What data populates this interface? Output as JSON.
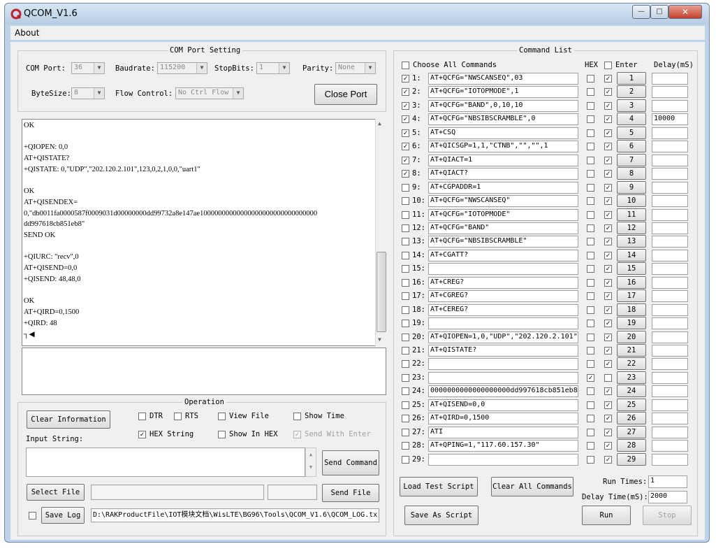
{
  "window": {
    "title": "QCOM_V1.6",
    "minimize_glyph": "—",
    "maximize_glyph": "□",
    "close_glyph": "✕"
  },
  "menu": {
    "about": "About"
  },
  "com_port": {
    "group_title": "COM Port Setting",
    "port_label": "COM Port:",
    "port_value": "36",
    "baud_label": "Baudrate:",
    "baud_value": "115200",
    "stopbits_label": "StopBits:",
    "stopbits_value": "1",
    "parity_label": "Parity:",
    "parity_value": "None",
    "bytesize_label": "ByteSize:",
    "bytesize_value": "8",
    "flow_label": "Flow Control:",
    "flow_value": "No Ctrl Flow",
    "close_port": "Close Port"
  },
  "log_lines": [
    "OK",
    "",
    "+QIOPEN: 0,0",
    "AT+QISTATE?",
    "+QISTATE: 0,\"UDP\",\"202.120.2.101\",123,0,2,1,0,0,\"uart1\"",
    "",
    "OK",
    "AT+QISENDEX=",
    "0,\"db0011fa0000587f0009031d00000000dd99732a8e147ae10000000000000000000000000000000",
    "dd997618cb851eb8\"",
    "SEND OK",
    "",
    "+QIURC: \"recv\",0",
    "AT+QISEND=0,0",
    "+QISEND: 48,48,0",
    "",
    "OK",
    "AT+QIRD=0,1500",
    "+QIRD: 48",
    "┐◀"
  ],
  "operation": {
    "group_title": "Operation",
    "clear_info": "Clear Information",
    "dtr": "DTR",
    "rts": "RTS",
    "view_file": "View File",
    "show_time": "Show Time",
    "hex_string": "HEX String",
    "show_in_hex": "Show In HEX",
    "send_with_enter": "Send With Enter",
    "input_label": "Input String:",
    "send_command": "Send Command",
    "select_file": "Select File",
    "send_file": "Send File",
    "save_log": "Save Log",
    "log_path": "D:\\RAKProductFile\\IOT模块文档\\WisLTE\\BG96\\Tools\\QCOM_V1.6\\QCOM_LOG.tx"
  },
  "command_list": {
    "group_title": "Command List",
    "choose_all": "Choose All Commands",
    "hex_header": "HEX",
    "enter_header": "Enter",
    "delay_header": "Delay(mS)",
    "rows": [
      {
        "num": "1:",
        "checked": true,
        "cmd": "AT+QCFG=\"NWSCANSEQ\",03",
        "hex": false,
        "enter": true,
        "btn": "1",
        "delay": ""
      },
      {
        "num": "2:",
        "checked": true,
        "cmd": "AT+QCFG=\"IOTOPMODE\",1",
        "hex": false,
        "enter": true,
        "btn": "2",
        "delay": ""
      },
      {
        "num": "3:",
        "checked": true,
        "cmd": "AT+QCFG=\"BAND\",0,10,10",
        "hex": false,
        "enter": true,
        "btn": "3",
        "delay": ""
      },
      {
        "num": "4:",
        "checked": true,
        "cmd": "AT+QCFG=\"NBSIBSCRAMBLE\",0",
        "hex": false,
        "enter": true,
        "btn": "4",
        "delay": "10000"
      },
      {
        "num": "5:",
        "checked": true,
        "cmd": "AT+CSQ",
        "hex": false,
        "enter": true,
        "btn": "5",
        "delay": ""
      },
      {
        "num": "6:",
        "checked": true,
        "cmd": "AT+QICSGP=1,1,\"CTNB\",\"\",\"\",1",
        "hex": false,
        "enter": true,
        "btn": "6",
        "delay": ""
      },
      {
        "num": "7:",
        "checked": true,
        "cmd": "AT+QIACT=1",
        "hex": false,
        "enter": true,
        "btn": "7",
        "delay": ""
      },
      {
        "num": "8:",
        "checked": true,
        "cmd": "AT+QIACT?",
        "hex": false,
        "enter": true,
        "btn": "8",
        "delay": ""
      },
      {
        "num": "9:",
        "checked": false,
        "cmd": "AT+CGPADDR=1",
        "hex": false,
        "enter": true,
        "btn": "9",
        "delay": ""
      },
      {
        "num": "10:",
        "checked": false,
        "cmd": "AT+QCFG=\"NWSCANSEQ\"",
        "hex": false,
        "enter": true,
        "btn": "10",
        "delay": ""
      },
      {
        "num": "11:",
        "checked": false,
        "cmd": "AT+QCFG=\"IOTOPMODE\"",
        "hex": false,
        "enter": true,
        "btn": "11",
        "delay": ""
      },
      {
        "num": "12:",
        "checked": false,
        "cmd": "AT+QCFG=\"BAND\"",
        "hex": false,
        "enter": true,
        "btn": "12",
        "delay": ""
      },
      {
        "num": "13:",
        "checked": false,
        "cmd": "AT+QCFG=\"NBSIBSCRAMBLE\"",
        "hex": false,
        "enter": true,
        "btn": "13",
        "delay": ""
      },
      {
        "num": "14:",
        "checked": false,
        "cmd": "AT+CGATT?",
        "hex": false,
        "enter": true,
        "btn": "14",
        "delay": ""
      },
      {
        "num": "15:",
        "checked": false,
        "cmd": "",
        "hex": false,
        "enter": true,
        "btn": "15",
        "delay": ""
      },
      {
        "num": "16:",
        "checked": false,
        "cmd": "AT+CREG?",
        "hex": false,
        "enter": true,
        "btn": "16",
        "delay": ""
      },
      {
        "num": "17:",
        "checked": false,
        "cmd": "AT+CGREG?",
        "hex": false,
        "enter": true,
        "btn": "17",
        "delay": ""
      },
      {
        "num": "18:",
        "checked": false,
        "cmd": "AT+CEREG?",
        "hex": false,
        "enter": true,
        "btn": "18",
        "delay": ""
      },
      {
        "num": "19:",
        "checked": false,
        "cmd": "",
        "hex": false,
        "enter": true,
        "btn": "19",
        "delay": ""
      },
      {
        "num": "20:",
        "checked": false,
        "cmd": "AT+QIOPEN=1,0,\"UDP\",\"202.120.2.101\",",
        "hex": false,
        "enter": true,
        "btn": "20",
        "delay": ""
      },
      {
        "num": "21:",
        "checked": false,
        "cmd": "AT+QISTATE?",
        "hex": false,
        "enter": true,
        "btn": "21",
        "delay": ""
      },
      {
        "num": "22:",
        "checked": false,
        "cmd": "",
        "hex": false,
        "enter": true,
        "btn": "22",
        "delay": ""
      },
      {
        "num": "23:",
        "checked": false,
        "cmd": "",
        "hex": true,
        "enter": false,
        "btn": "23",
        "delay": ""
      },
      {
        "num": "24:",
        "checked": false,
        "cmd": "0000000000000000000dd997618cb851eb8\"",
        "hex": false,
        "enter": true,
        "btn": "24",
        "delay": ""
      },
      {
        "num": "25:",
        "checked": false,
        "cmd": "AT+QISEND=0,0",
        "hex": false,
        "enter": true,
        "btn": "25",
        "delay": ""
      },
      {
        "num": "26:",
        "checked": false,
        "cmd": "AT+QIRD=0,1500",
        "hex": false,
        "enter": true,
        "btn": "26",
        "delay": ""
      },
      {
        "num": "27:",
        "checked": false,
        "cmd": "ATI",
        "hex": false,
        "enter": true,
        "btn": "27",
        "delay": ""
      },
      {
        "num": "28:",
        "checked": false,
        "cmd": "AT+QPING=1,\"117.60.157.30\"",
        "hex": false,
        "enter": true,
        "btn": "28",
        "delay": ""
      },
      {
        "num": "29:",
        "checked": false,
        "cmd": "",
        "hex": false,
        "enter": true,
        "btn": "29",
        "delay": ""
      }
    ],
    "load_script": "Load Test Script",
    "clear_all": "Clear All Commands",
    "save_script": "Save As Script",
    "run_times_label": "Run Times:",
    "run_times_value": "1",
    "delay_time_label": "Delay Time(mS):",
    "delay_time_value": "2000",
    "run": "Run",
    "stop": "Stop"
  },
  "colors": {
    "frame": "#bcd3ea",
    "dialog": "#f0f0f0",
    "close_button": "#c3402c"
  }
}
